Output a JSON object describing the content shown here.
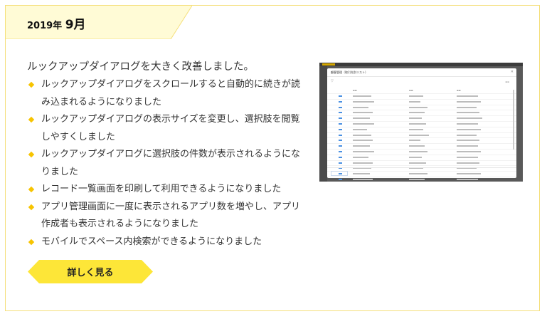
{
  "header": {
    "year": "2019年",
    "month": "9月",
    "tab_color": "#fffbd6",
    "tab_border_color": "#f5df7a"
  },
  "main": {
    "intro": "ルックアップダイアログを大きく改善しました。",
    "items": [
      "ルックアップダイアログをスクロールすると自動的に続きが読み込まれるようになりました",
      "ルックアップダイアログの表示サイズを変更し、選択肢を閲覧しやすくしました",
      "ルックアップダイアログに選択肢の件数が表示されるようになりました",
      "レコード一覧画面を印刷して利用できるようになりました",
      "アプリ管理画面に一度に表示されるアプリ数を増やし、アプリ作成者も表示されるようになりました",
      "モバイルでスペース内検索ができるようになりました"
    ],
    "bullet_color": "#f7c400",
    "bullet_icon": "diamond-bullet-icon"
  },
  "button": {
    "label": "詳しく見る",
    "color": "#fde638"
  },
  "thumbnail": {
    "dialog_title": "顧客管理（取引先別リスト）"
  }
}
